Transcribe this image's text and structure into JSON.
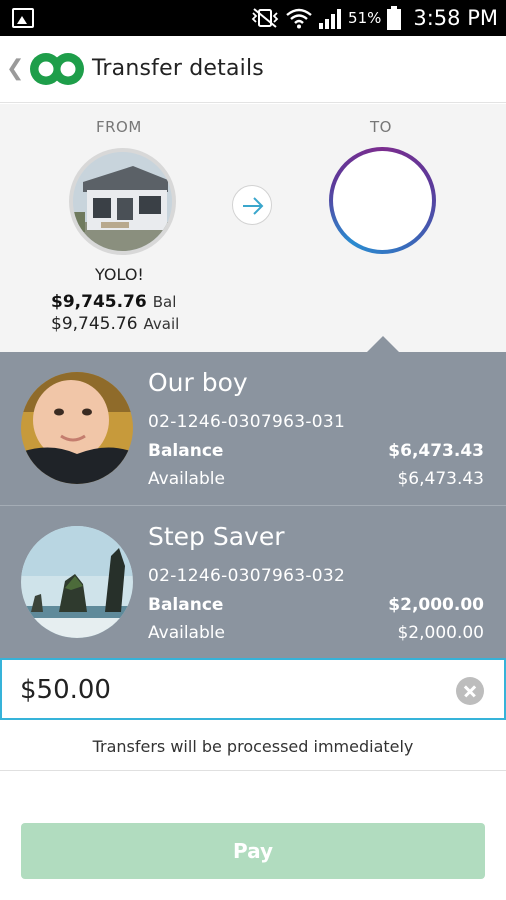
{
  "status_bar": {
    "battery_percent": "51%",
    "time": "3:58 PM",
    "icons": [
      "image-icon",
      "vibrate-mute-icon",
      "wifi-icon",
      "signal-icon",
      "battery-icon"
    ]
  },
  "header": {
    "back_icon": "chevron-left-icon",
    "logo": "infinity-logo",
    "title": "Transfer details"
  },
  "transfer": {
    "from_label": "FROM",
    "to_label": "TO",
    "from_account": {
      "name": "YOLO!",
      "balance": "$9,745.76",
      "balance_suffix": "Bal",
      "available": "$9,745.76",
      "available_suffix": "Avail"
    }
  },
  "accounts": [
    {
      "name": "Our boy",
      "number": "02-1246-0307963-031",
      "balance_label": "Balance",
      "balance": "$6,473.43",
      "available_label": "Available",
      "available": "$6,473.43"
    },
    {
      "name": "Step Saver",
      "number": "02-1246-0307963-032",
      "balance_label": "Balance",
      "balance": "$2,000.00",
      "available_label": "Available",
      "available": "$2,000.00"
    }
  ],
  "amount": {
    "value": "$50.00"
  },
  "notice": "Transfers will be processed immediately",
  "pay_button": "Pay",
  "colors": {
    "accent_green": "#1e9e4a",
    "input_border": "#36b3d9",
    "accounts_bg": "#8b949f",
    "pay_disabled": "#b1dcbf"
  }
}
